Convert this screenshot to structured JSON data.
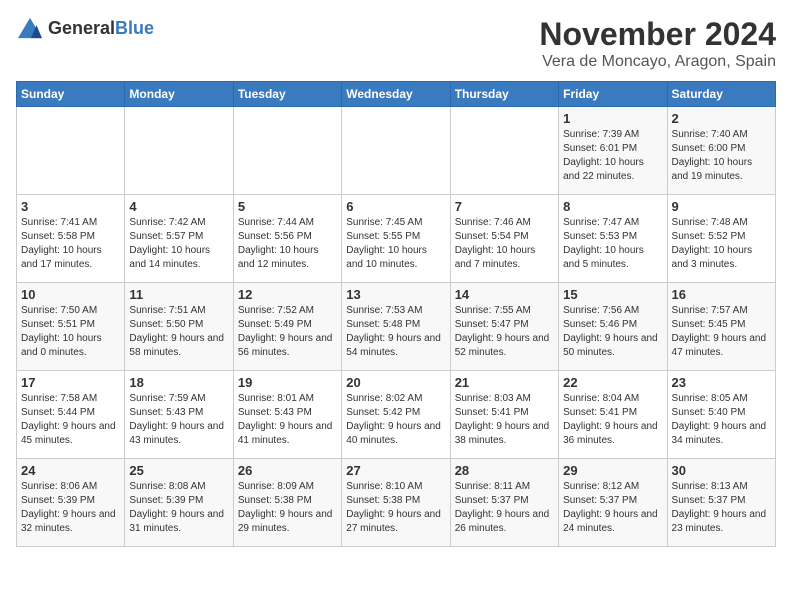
{
  "logo": {
    "general": "General",
    "blue": "Blue"
  },
  "header": {
    "month": "November 2024",
    "location": "Vera de Moncayo, Aragon, Spain"
  },
  "weekdays": [
    "Sunday",
    "Monday",
    "Tuesday",
    "Wednesday",
    "Thursday",
    "Friday",
    "Saturday"
  ],
  "weeks": [
    [
      {
        "day": "",
        "info": ""
      },
      {
        "day": "",
        "info": ""
      },
      {
        "day": "",
        "info": ""
      },
      {
        "day": "",
        "info": ""
      },
      {
        "day": "",
        "info": ""
      },
      {
        "day": "1",
        "info": "Sunrise: 7:39 AM\nSunset: 6:01 PM\nDaylight: 10 hours and 22 minutes."
      },
      {
        "day": "2",
        "info": "Sunrise: 7:40 AM\nSunset: 6:00 PM\nDaylight: 10 hours and 19 minutes."
      }
    ],
    [
      {
        "day": "3",
        "info": "Sunrise: 7:41 AM\nSunset: 5:58 PM\nDaylight: 10 hours and 17 minutes."
      },
      {
        "day": "4",
        "info": "Sunrise: 7:42 AM\nSunset: 5:57 PM\nDaylight: 10 hours and 14 minutes."
      },
      {
        "day": "5",
        "info": "Sunrise: 7:44 AM\nSunset: 5:56 PM\nDaylight: 10 hours and 12 minutes."
      },
      {
        "day": "6",
        "info": "Sunrise: 7:45 AM\nSunset: 5:55 PM\nDaylight: 10 hours and 10 minutes."
      },
      {
        "day": "7",
        "info": "Sunrise: 7:46 AM\nSunset: 5:54 PM\nDaylight: 10 hours and 7 minutes."
      },
      {
        "day": "8",
        "info": "Sunrise: 7:47 AM\nSunset: 5:53 PM\nDaylight: 10 hours and 5 minutes."
      },
      {
        "day": "9",
        "info": "Sunrise: 7:48 AM\nSunset: 5:52 PM\nDaylight: 10 hours and 3 minutes."
      }
    ],
    [
      {
        "day": "10",
        "info": "Sunrise: 7:50 AM\nSunset: 5:51 PM\nDaylight: 10 hours and 0 minutes."
      },
      {
        "day": "11",
        "info": "Sunrise: 7:51 AM\nSunset: 5:50 PM\nDaylight: 9 hours and 58 minutes."
      },
      {
        "day": "12",
        "info": "Sunrise: 7:52 AM\nSunset: 5:49 PM\nDaylight: 9 hours and 56 minutes."
      },
      {
        "day": "13",
        "info": "Sunrise: 7:53 AM\nSunset: 5:48 PM\nDaylight: 9 hours and 54 minutes."
      },
      {
        "day": "14",
        "info": "Sunrise: 7:55 AM\nSunset: 5:47 PM\nDaylight: 9 hours and 52 minutes."
      },
      {
        "day": "15",
        "info": "Sunrise: 7:56 AM\nSunset: 5:46 PM\nDaylight: 9 hours and 50 minutes."
      },
      {
        "day": "16",
        "info": "Sunrise: 7:57 AM\nSunset: 5:45 PM\nDaylight: 9 hours and 47 minutes."
      }
    ],
    [
      {
        "day": "17",
        "info": "Sunrise: 7:58 AM\nSunset: 5:44 PM\nDaylight: 9 hours and 45 minutes."
      },
      {
        "day": "18",
        "info": "Sunrise: 7:59 AM\nSunset: 5:43 PM\nDaylight: 9 hours and 43 minutes."
      },
      {
        "day": "19",
        "info": "Sunrise: 8:01 AM\nSunset: 5:43 PM\nDaylight: 9 hours and 41 minutes."
      },
      {
        "day": "20",
        "info": "Sunrise: 8:02 AM\nSunset: 5:42 PM\nDaylight: 9 hours and 40 minutes."
      },
      {
        "day": "21",
        "info": "Sunrise: 8:03 AM\nSunset: 5:41 PM\nDaylight: 9 hours and 38 minutes."
      },
      {
        "day": "22",
        "info": "Sunrise: 8:04 AM\nSunset: 5:41 PM\nDaylight: 9 hours and 36 minutes."
      },
      {
        "day": "23",
        "info": "Sunrise: 8:05 AM\nSunset: 5:40 PM\nDaylight: 9 hours and 34 minutes."
      }
    ],
    [
      {
        "day": "24",
        "info": "Sunrise: 8:06 AM\nSunset: 5:39 PM\nDaylight: 9 hours and 32 minutes."
      },
      {
        "day": "25",
        "info": "Sunrise: 8:08 AM\nSunset: 5:39 PM\nDaylight: 9 hours and 31 minutes."
      },
      {
        "day": "26",
        "info": "Sunrise: 8:09 AM\nSunset: 5:38 PM\nDaylight: 9 hours and 29 minutes."
      },
      {
        "day": "27",
        "info": "Sunrise: 8:10 AM\nSunset: 5:38 PM\nDaylight: 9 hours and 27 minutes."
      },
      {
        "day": "28",
        "info": "Sunrise: 8:11 AM\nSunset: 5:37 PM\nDaylight: 9 hours and 26 minutes."
      },
      {
        "day": "29",
        "info": "Sunrise: 8:12 AM\nSunset: 5:37 PM\nDaylight: 9 hours and 24 minutes."
      },
      {
        "day": "30",
        "info": "Sunrise: 8:13 AM\nSunset: 5:37 PM\nDaylight: 9 hours and 23 minutes."
      }
    ]
  ]
}
